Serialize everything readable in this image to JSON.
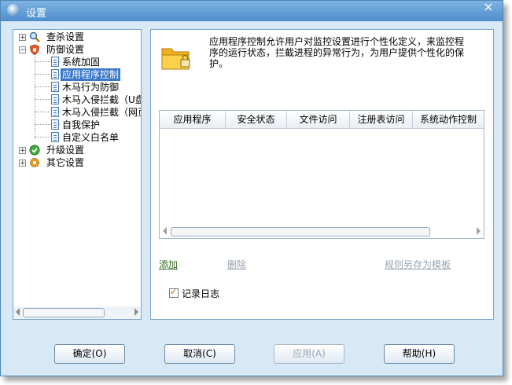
{
  "window": {
    "title": "设置",
    "close_label": "×"
  },
  "tree": {
    "items": [
      {
        "label": "查杀设置",
        "icon": "magnifier-icon"
      },
      {
        "label": "防御设置",
        "icon": "shield-icon"
      },
      {
        "label": "系统加固"
      },
      {
        "label": "应用程序控制"
      },
      {
        "label": "木马行为防御"
      },
      {
        "label": "木马入侵拦截（U盘"
      },
      {
        "label": "木马入侵拦截（网页"
      },
      {
        "label": "自我保护"
      },
      {
        "label": "自定义白名单"
      },
      {
        "label": "升级设置",
        "icon": "update-icon"
      },
      {
        "label": "其它设置",
        "icon": "gear-icon"
      }
    ]
  },
  "main": {
    "description": "应用程序控制允许用户对监控设置进行个性化定义，来监控程序的运行状态，拦截进程的异常行为，为用户提供个性化的保护。",
    "table_headers": [
      "应用程序",
      "安全状态",
      "文件访问",
      "注册表访问",
      "系统动作控制"
    ],
    "add_link": "添加",
    "delete_link": "删除",
    "save_template_link": "规则另存为模板",
    "log_checkbox_label": "记录日志",
    "log_checked": true
  },
  "buttons": {
    "ok": "确定(O)",
    "cancel": "取消(C)",
    "apply": "应用(A)",
    "help": "帮助(H)"
  }
}
